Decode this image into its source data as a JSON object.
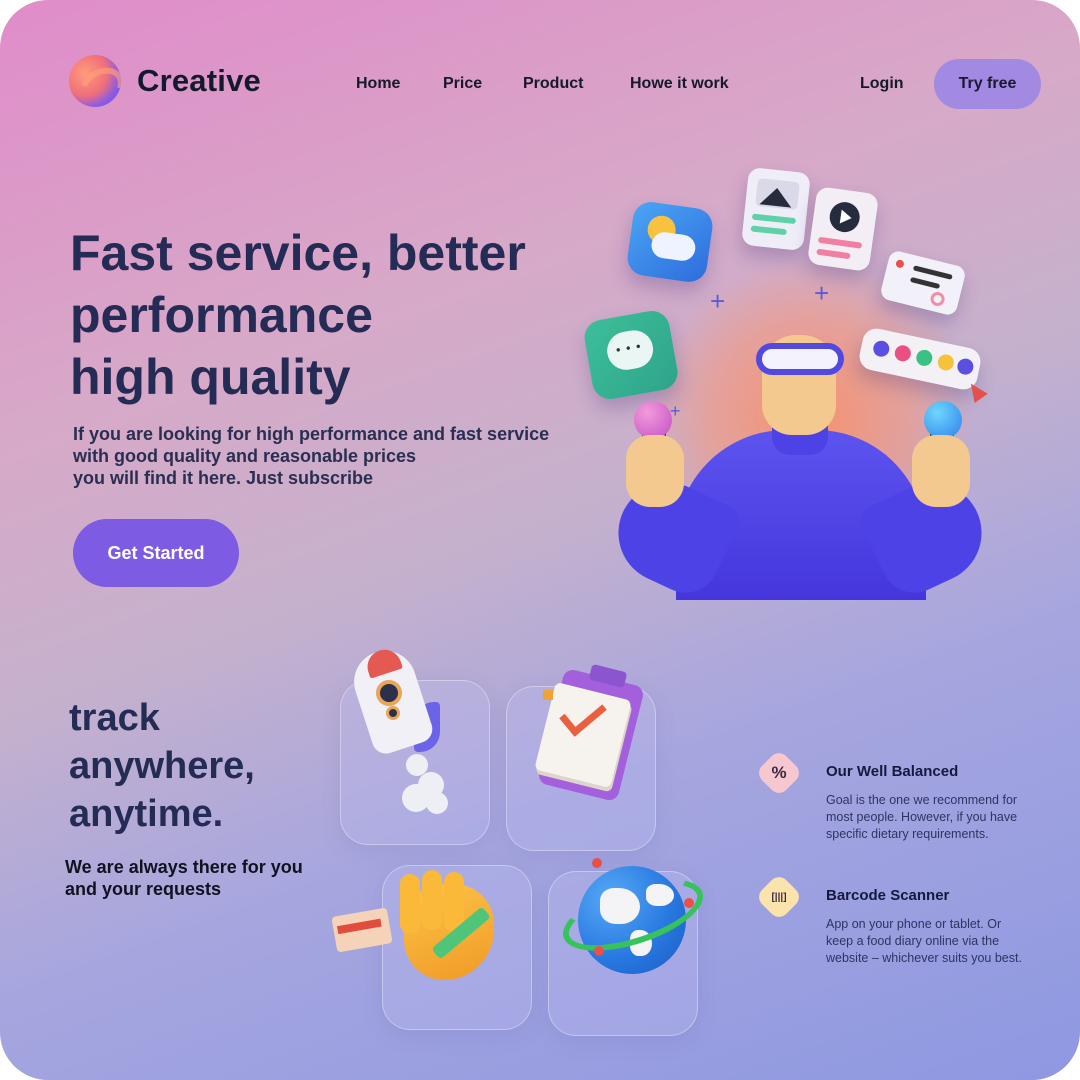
{
  "brand": {
    "name": "Creative"
  },
  "nav": {
    "items": [
      {
        "label": "Home"
      },
      {
        "label": "Price"
      },
      {
        "label": "Product"
      },
      {
        "label": "Howe it work"
      }
    ],
    "login_label": "Login",
    "try_label": "Try free"
  },
  "hero": {
    "title_lines": [
      "Fast service, better",
      "performance",
      "high quality"
    ],
    "subtitle_lines": [
      "If you are looking for high performance and fast service",
      "with good quality and reasonable prices",
      "you will find it here. Just subscribe"
    ],
    "cta_label": "Get Started"
  },
  "track": {
    "title_lines": [
      "track",
      "anywhere,",
      "anytime."
    ],
    "subtitle_lines": [
      "We are always there for you",
      "and your requests"
    ]
  },
  "features": [
    {
      "icon": "percent-icon",
      "icon_glyph": "%",
      "title": "Our Well Balanced",
      "desc_lines": [
        "Goal is the one we recommend for",
        "most people. However, if you have",
        "specific dietary requirements."
      ]
    },
    {
      "icon": "barcode-scan-icon",
      "icon_glyph": "[|||]",
      "title": "Barcode Scanner",
      "desc_lines": [
        "App on your phone or tablet. Or",
        "keep a food diary online via the",
        "website – whichever suits you best."
      ]
    }
  ],
  "colors": {
    "accent": "#7d5be3",
    "try_button": "#a28ae2",
    "heading": "#242b54"
  }
}
